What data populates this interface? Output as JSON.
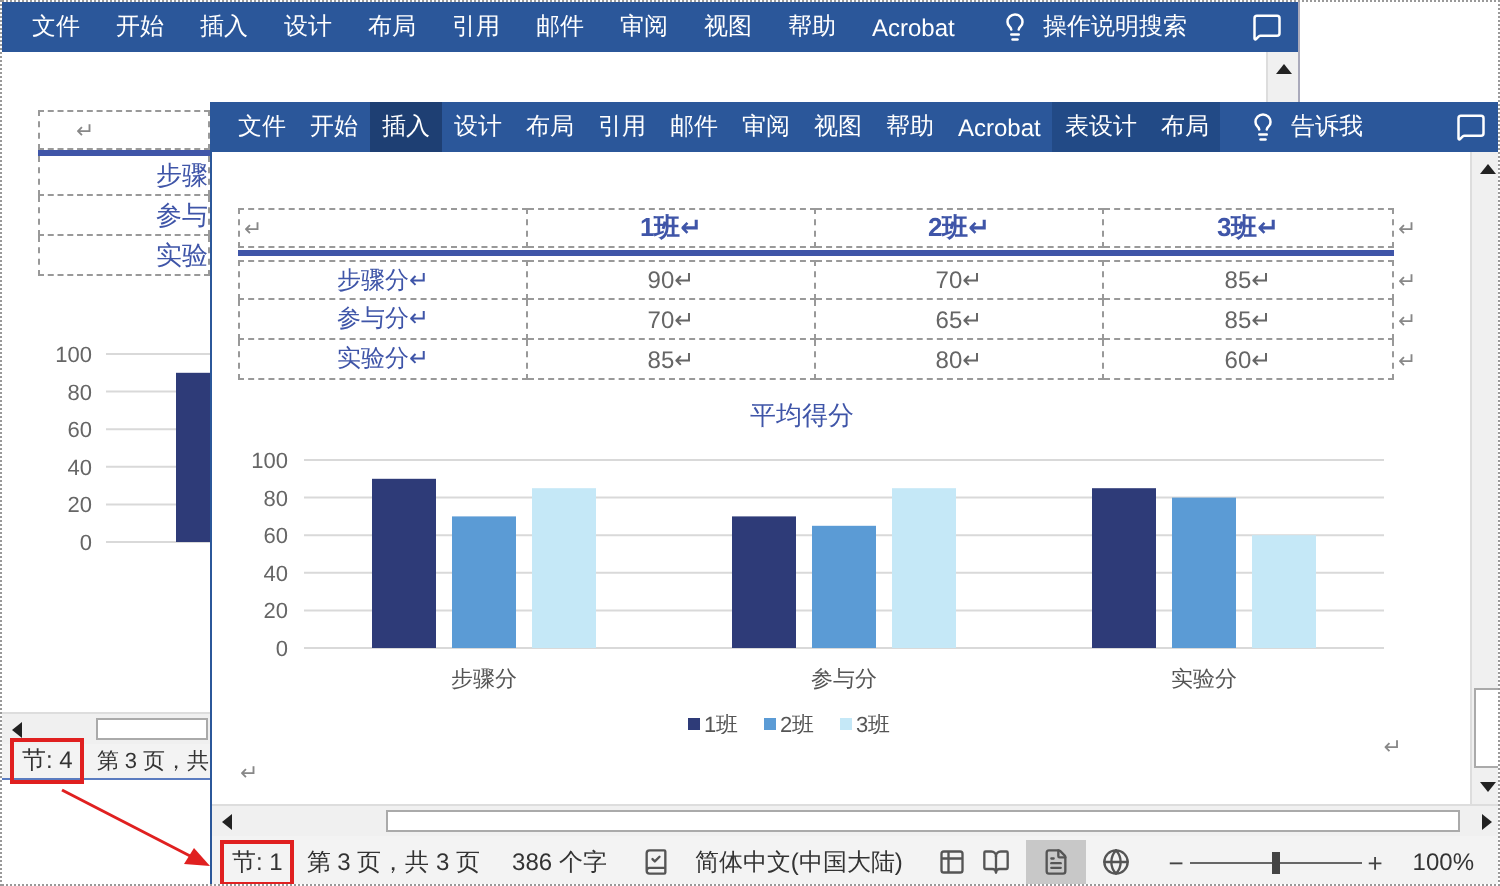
{
  "back_window": {
    "ribbon_tabs": [
      {
        "label": "文件",
        "selected": false
      },
      {
        "label": "开始",
        "selected": false
      },
      {
        "label": "插入",
        "selected": false
      },
      {
        "label": "设计",
        "selected": false
      },
      {
        "label": "布局",
        "selected": false
      },
      {
        "label": "引用",
        "selected": false
      },
      {
        "label": "邮件",
        "selected": false
      },
      {
        "label": "审阅",
        "selected": false
      },
      {
        "label": "视图",
        "selected": false
      },
      {
        "label": "帮助",
        "selected": false
      },
      {
        "label": "Acrobat",
        "selected": false
      }
    ],
    "search": "操作说明搜索",
    "table": {
      "header": "↵",
      "rows": [
        "步骤",
        "参与",
        "实验"
      ]
    },
    "chart_data": {
      "type": "bar",
      "grid": true,
      "ylim": [
        0,
        100
      ],
      "yticks": [
        0,
        20,
        40,
        60,
        80,
        100
      ],
      "values": [
        90
      ]
    },
    "status_bar": {
      "section": "节: 4",
      "section_highlighted": true,
      "page": "第 3 页，共"
    }
  },
  "front_window": {
    "ribbon_tabs": [
      {
        "label": "文件",
        "selected": false,
        "contextual": false
      },
      {
        "label": "开始",
        "selected": false,
        "contextual": false
      },
      {
        "label": "插入",
        "selected": true,
        "contextual": false
      },
      {
        "label": "设计",
        "selected": false,
        "contextual": false
      },
      {
        "label": "布局",
        "selected": false,
        "contextual": false
      },
      {
        "label": "引用",
        "selected": false,
        "contextual": false
      },
      {
        "label": "邮件",
        "selected": false,
        "contextual": false
      },
      {
        "label": "审阅",
        "selected": false,
        "contextual": false
      },
      {
        "label": "视图",
        "selected": false,
        "contextual": false
      },
      {
        "label": "帮助",
        "selected": false,
        "contextual": false
      },
      {
        "label": "Acrobat",
        "selected": false,
        "contextual": false
      },
      {
        "label": "表设计",
        "selected": false,
        "contextual": true
      },
      {
        "label": "布局",
        "selected": false,
        "contextual": true
      }
    ],
    "search": "告诉我",
    "table": {
      "header": {
        "cells": [
          "↵",
          "1班↵",
          "2班↵",
          "3班↵"
        ],
        "end": "↵"
      },
      "rows": [
        {
          "cells": [
            "步骤分↵",
            "90↵",
            "70↵",
            "85↵"
          ],
          "end": "↵"
        },
        {
          "cells": [
            "参与分↵",
            "70↵",
            "65↵",
            "85↵"
          ],
          "end": "↵"
        },
        {
          "cells": [
            "实验分↵",
            "85↵",
            "80↵",
            "60↵"
          ],
          "end": "↵"
        }
      ]
    },
    "chart_data": {
      "type": "bar",
      "title": "平均得分",
      "grid": true,
      "legend": "bottom",
      "categories": [
        "步骤分",
        "参与分",
        "实验分"
      ],
      "ylim": [
        0,
        100
      ],
      "yticks": [
        0,
        20,
        40,
        60,
        80,
        100
      ],
      "series": [
        {
          "name": "1班",
          "color": "#2e3b78",
          "values": [
            90,
            70,
            85
          ]
        },
        {
          "name": "2班",
          "color": "#5b9bd5",
          "values": [
            70,
            65,
            80
          ]
        },
        {
          "name": "3班",
          "color": "#c5e8f7",
          "values": [
            85,
            85,
            60
          ]
        }
      ]
    },
    "paragraph_marks": [
      "↵",
      "↵"
    ],
    "status_bar": {
      "section": "节: 1",
      "section_highlighted": true,
      "page": "第 3 页，共 3 页",
      "words": "386 个字",
      "language": "简体中文(中国大陆)",
      "views": [
        {
          "kind": "read",
          "selected": false
        },
        {
          "kind": "print",
          "selected": true
        },
        {
          "kind": "web",
          "selected": false
        }
      ],
      "zoom_out": "−",
      "zoom_in": "+",
      "zoom": {
        "level": 0.5
      },
      "zoom_label": "100%"
    }
  }
}
